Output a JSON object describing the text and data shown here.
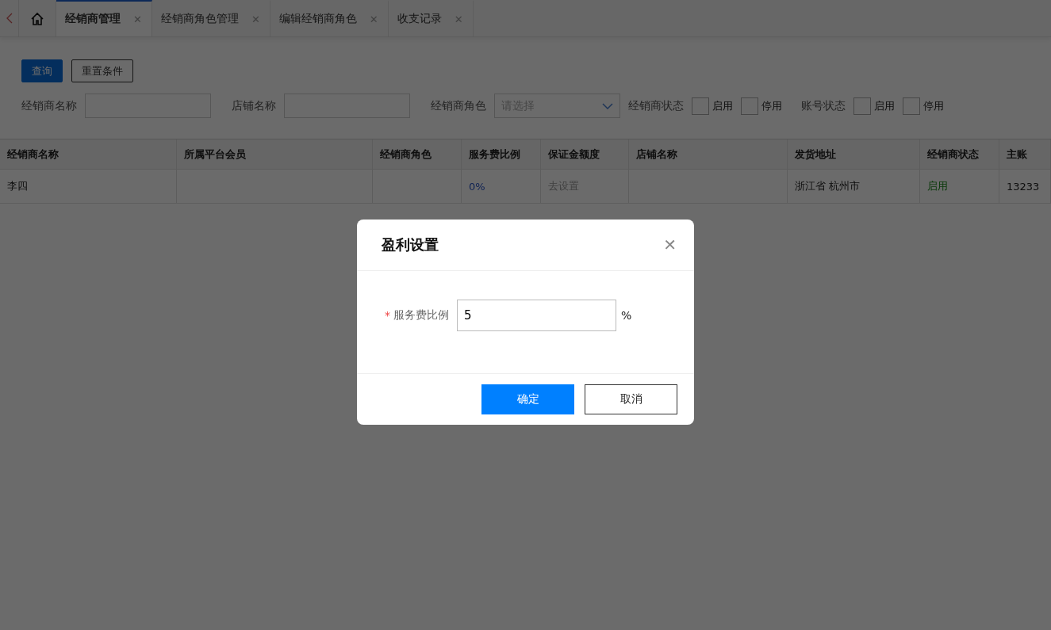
{
  "tabs": [
    {
      "kind": "home",
      "selected": false
    },
    {
      "kind": "page",
      "label": "经销商管理",
      "selected": true,
      "close": "✕"
    },
    {
      "kind": "page",
      "label": "经销商角色管理",
      "selected": false,
      "close": "✕"
    },
    {
      "kind": "page",
      "label": "编辑经销商角色",
      "selected": false,
      "close": "✕"
    },
    {
      "kind": "page",
      "label": "收支记录",
      "selected": false,
      "close": "✕"
    }
  ],
  "buttons": [
    {
      "label": "查询",
      "primary": true
    },
    {
      "label": "重置条件",
      "primary": false
    }
  ],
  "filters": [
    {
      "kind": "text",
      "label": "经销商名称"
    },
    {
      "kind": "text",
      "label": "店铺名称"
    },
    {
      "kind": "select",
      "label": "经销商角色",
      "placeholder": "请选择"
    },
    {
      "kind": "checks",
      "label": "经销商状态",
      "options": [
        {
          "label": "启用",
          "checked": false
        },
        {
          "label": "停用",
          "checked": false
        }
      ]
    },
    {
      "kind": "checks",
      "label": "账号状态",
      "options": [
        {
          "label": "启用",
          "checked": false
        },
        {
          "label": "停用",
          "checked": false
        }
      ]
    }
  ],
  "table": {
    "columns": [
      "经销商名称",
      "所属平台会员",
      "经销商角色",
      "服务费比例",
      "保证金额度",
      "店铺名称",
      "发货地址",
      "经销商状态",
      "主账"
    ],
    "rows": [
      [
        {
          "text": "李四"
        },
        {
          "text": ""
        },
        {
          "text": ""
        },
        {
          "text": "0%",
          "kind": "link"
        },
        {
          "text": "去设置",
          "kind": "muted"
        },
        {
          "text": ""
        },
        {
          "text": "浙江省 杭州市"
        },
        {
          "text": "启用",
          "kind": "status"
        },
        {
          "text": "13233"
        }
      ]
    ]
  },
  "dialog": {
    "title": "盈利设置",
    "close": "✕",
    "field": {
      "required_mark": "*",
      "label": "服务费比例",
      "value": "5",
      "unit": "%"
    },
    "buttons": [
      {
        "label": "确定",
        "primary": true
      },
      {
        "label": "取消",
        "primary": false
      }
    ]
  }
}
